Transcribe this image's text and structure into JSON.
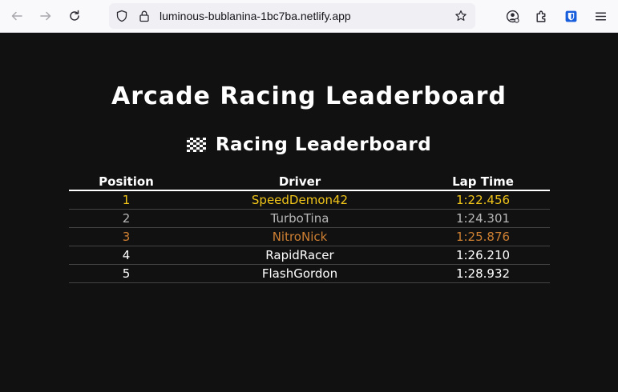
{
  "browser": {
    "url": "luminous-bublanina-1bc7ba.netlify.app"
  },
  "page": {
    "title": "Arcade Racing Leaderboard",
    "subtitle": "Racing Leaderboard",
    "subtitle_icon": "checkered-flag-icon"
  },
  "leaderboard": {
    "headers": [
      "Position",
      "Driver",
      "Lap Time"
    ],
    "rows": [
      {
        "position": "1",
        "driver": "SpeedDemon42",
        "lap_time": "1:22.456",
        "color": "#f0c419"
      },
      {
        "position": "2",
        "driver": "TurboTina",
        "lap_time": "1:24.301",
        "color": "#b8b8b8"
      },
      {
        "position": "3",
        "driver": "NitroNick",
        "lap_time": "1:25.876",
        "color": "#cd7f32"
      },
      {
        "position": "4",
        "driver": "RapidRacer",
        "lap_time": "1:26.210",
        "color": "#ffffff"
      },
      {
        "position": "5",
        "driver": "FlashGordon",
        "lap_time": "1:28.932",
        "color": "#ffffff"
      }
    ]
  }
}
